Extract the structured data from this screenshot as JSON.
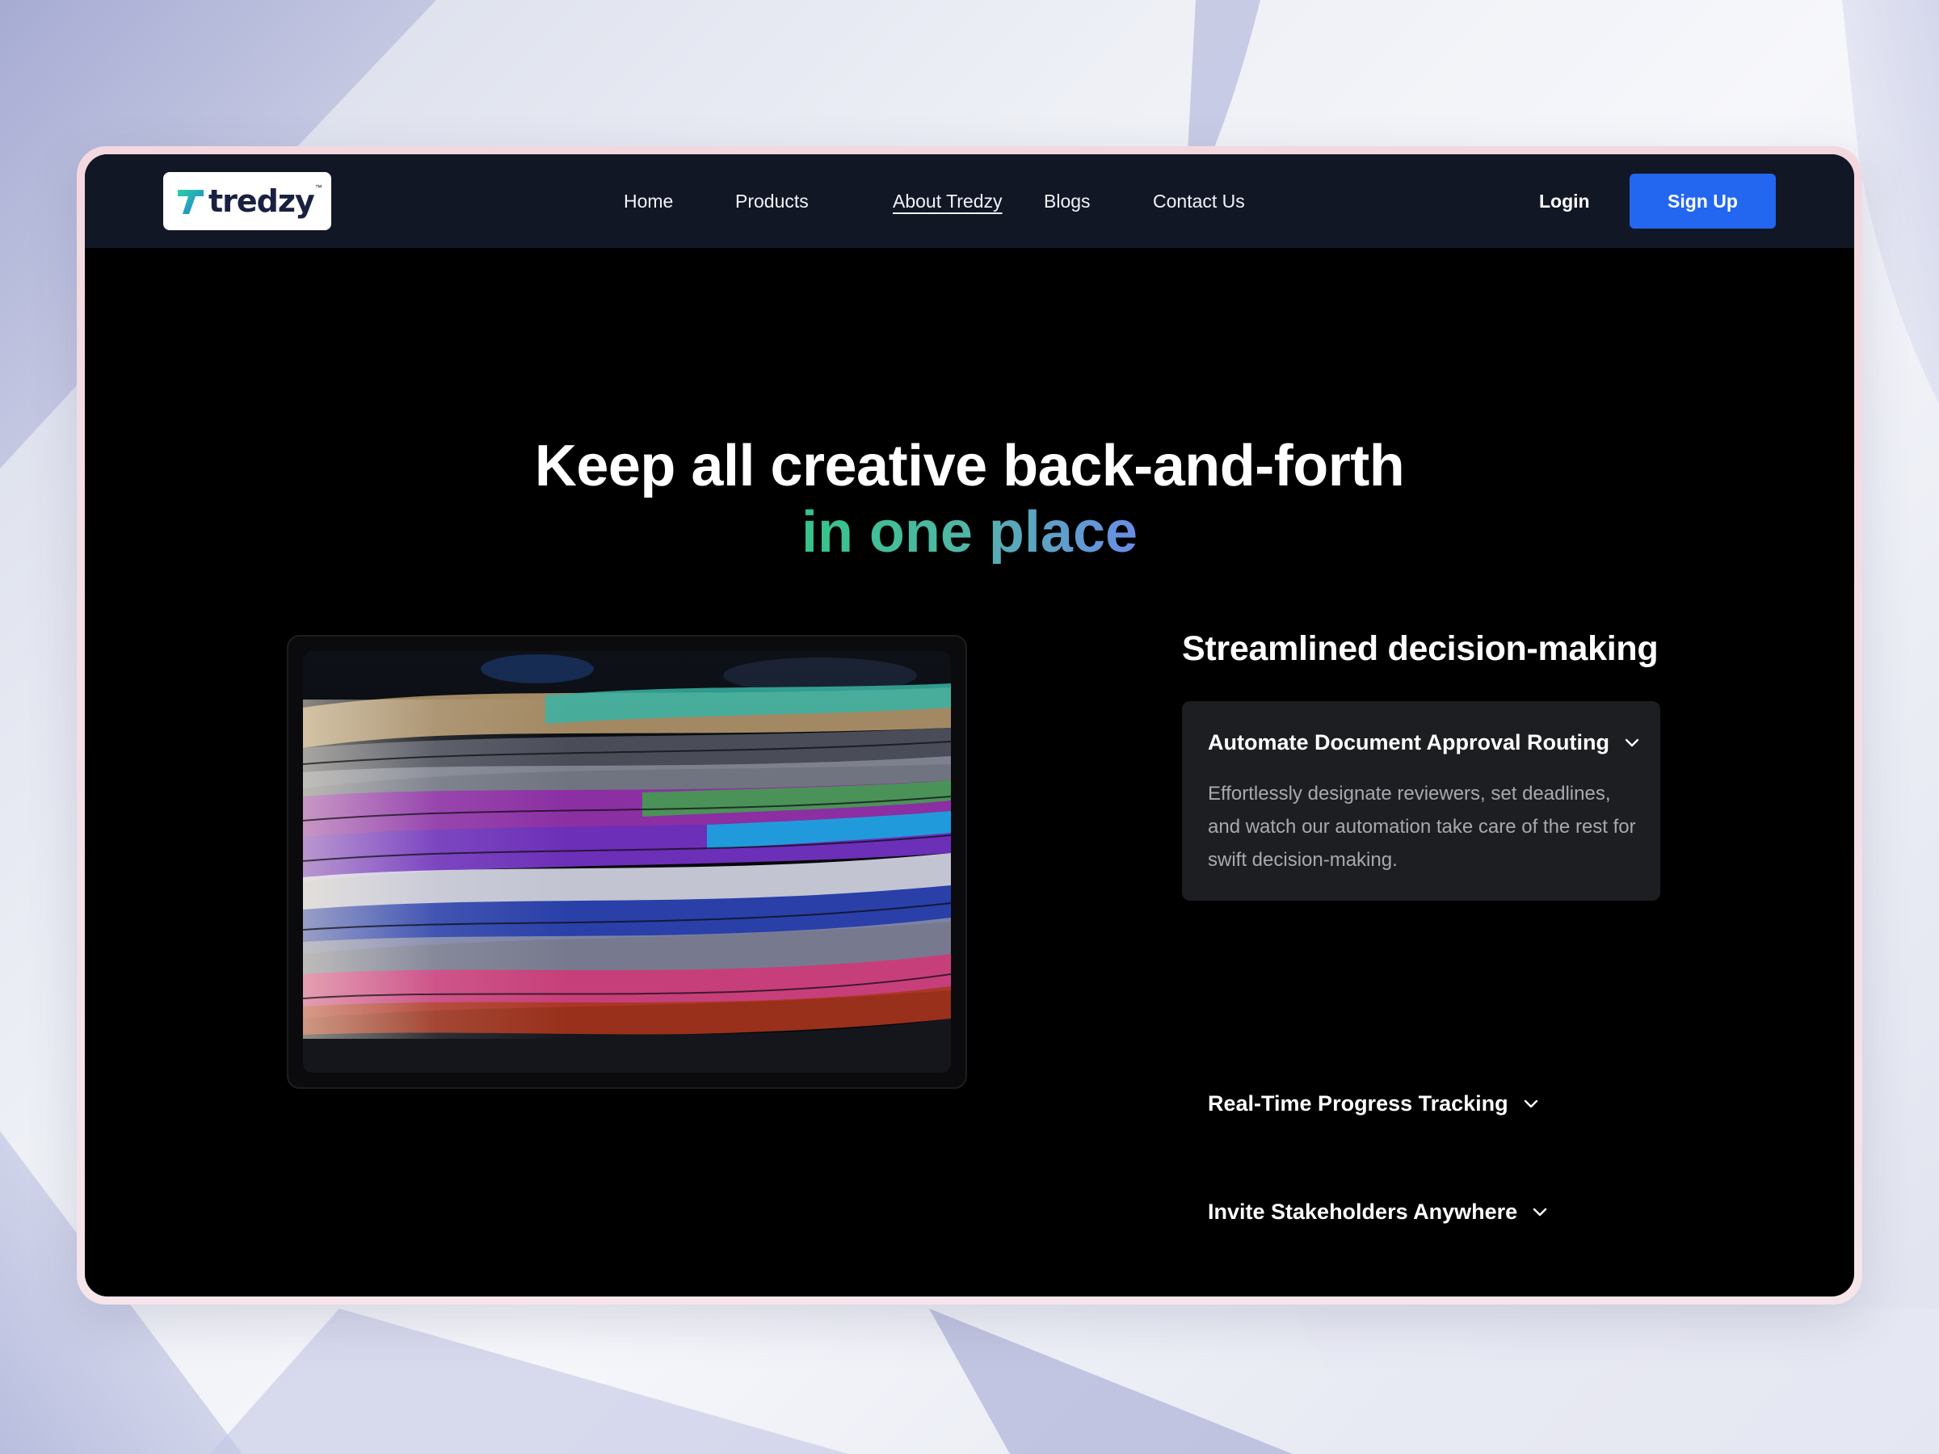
{
  "brand": {
    "name": "tredzy",
    "trademark": "™"
  },
  "nav": {
    "items": [
      {
        "label": "Home"
      },
      {
        "label": "Products"
      },
      {
        "label": "About Tredzy"
      },
      {
        "label": "Blogs"
      },
      {
        "label": "Contact Us"
      }
    ],
    "active_label": "About Tredzy",
    "login_label": "Login",
    "signup_label": "Sign Up"
  },
  "hero": {
    "title": "Keep all creative back-and-forth",
    "accent": "in one place"
  },
  "feature": {
    "title": "Streamlined decision-making",
    "accordion": [
      {
        "title": "Automate Document Approval Routing",
        "body": "Effortlessly designate reviewers, set deadlines, and watch our automation take care of the rest for swift decision-making.",
        "expanded": true
      },
      {
        "title": "Real-Time Progress Tracking",
        "expanded": false
      },
      {
        "title": "Invite Stakeholders Anywhere",
        "expanded": false
      }
    ]
  },
  "colors": {
    "nav_bg": "#121726",
    "page_bg": "#000000",
    "accent_blue": "#2366f0",
    "accent_green": "#34c48a",
    "accent_violet": "#6a8de6",
    "card_bg": "#1d1e21"
  },
  "icons": {
    "logo": "tredzy-logo-icon",
    "accordion_toggle": "chevron-down-icon"
  }
}
